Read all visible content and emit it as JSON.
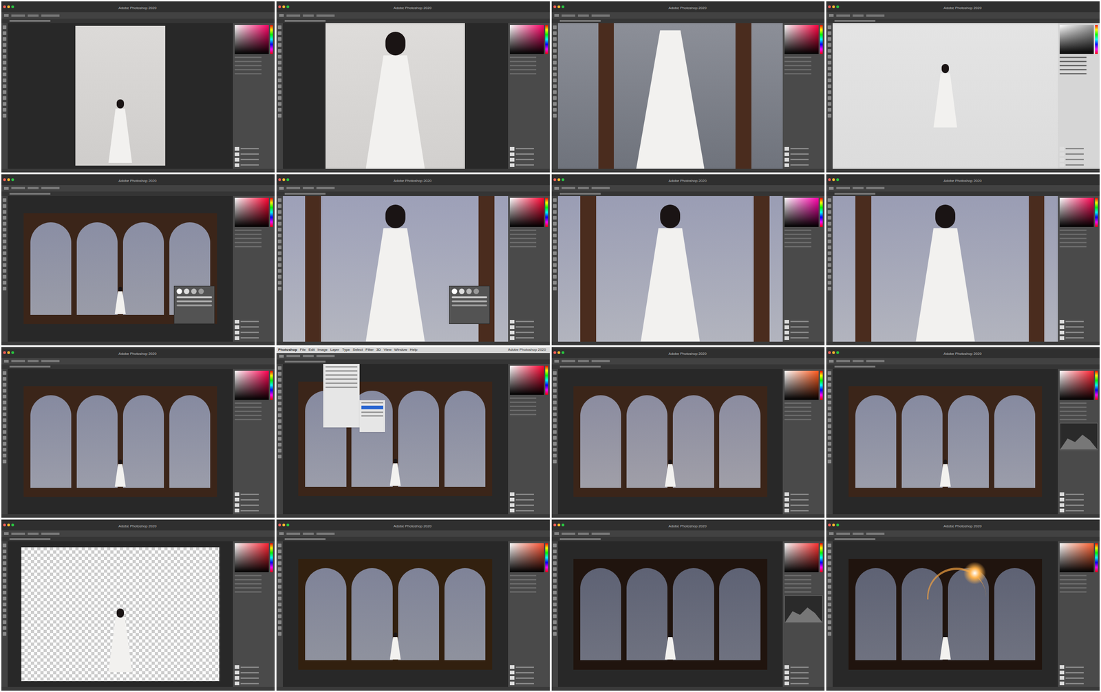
{
  "cells": [
    {
      "title": "Adobe Photoshop 2020",
      "kind": "studio-wide",
      "sky": "#dcdad8",
      "sea": "#cfcdcb",
      "frame": "#3b2519",
      "picker": "#ff0066",
      "overlay": "none"
    },
    {
      "title": "Adobe Photoshop 2020",
      "kind": "studio-zoom",
      "sky": "#dedcda",
      "sea": "#d2d0ce",
      "frame": "#3b2519",
      "picker": "#ff0066",
      "overlay": "none"
    },
    {
      "title": "Adobe Photoshop 2020",
      "kind": "closeup",
      "sky": "#8c8f98",
      "sea": "#6f737c",
      "frame": "#4a2c1e",
      "picker": "#ff0040",
      "overlay": "none"
    },
    {
      "title": "Adobe Photoshop 2020",
      "kind": "dialog",
      "sky": "#e4e4e4",
      "sea": "#dcdcdc",
      "frame": "#3b2519",
      "picker": "#9a9a9a",
      "overlay": "none"
    },
    {
      "title": "Adobe Photoshop 2020",
      "kind": "arches",
      "sky": "#8a8ea4",
      "sea": "#9a9ca8",
      "frame": "#3b2519",
      "picker": "#ff0030",
      "overlay": "brush"
    },
    {
      "title": "Adobe Photoshop 2020",
      "kind": "zoom",
      "sky": "#9da0b8",
      "sea": "#b4b6c0",
      "frame": "#4a2c1e",
      "picker": "#ff0030",
      "overlay": "brush"
    },
    {
      "title": "Adobe Photoshop 2020",
      "kind": "zoom",
      "sky": "#9a9db4",
      "sea": "#b2b4be",
      "frame": "#4a2c1e",
      "picker": "#ff00aa",
      "overlay": "none"
    },
    {
      "title": "Adobe Photoshop 2020",
      "kind": "zoom",
      "sky": "#9a9db4",
      "sea": "#b2b4be",
      "frame": "#4a2c1e",
      "picker": "#ff0050",
      "overlay": "none"
    },
    {
      "title": "Adobe Photoshop 2020",
      "kind": "arches",
      "sky": "#868aa0",
      "sea": "#9b9daa",
      "frame": "#3b2519",
      "picker": "#ff0050",
      "overlay": "none"
    },
    {
      "title": "Adobe Photoshop 2020",
      "kind": "arches",
      "sky": "#868aa0",
      "sea": "#9b9daa",
      "frame": "#3b2519",
      "picker": "#ff0030",
      "overlay": "menu",
      "menubar": [
        "Photoshop",
        "File",
        "Edit",
        "Image",
        "Layer",
        "Type",
        "Select",
        "Filter",
        "3D",
        "View",
        "Window",
        "Help"
      ]
    },
    {
      "title": "Adobe Photoshop 2020",
      "kind": "arches",
      "sky": "#8b8ca0",
      "sea": "#a09fa8",
      "frame": "#3b2519",
      "picker": "#ff5a1e",
      "overlay": "none"
    },
    {
      "title": "Adobe Photoshop 2020",
      "kind": "arches",
      "sky": "#868aa0",
      "sea": "#9b9daa",
      "frame": "#3b2519",
      "picker": "#ff2030",
      "overlay": "curves"
    },
    {
      "title": "Adobe Photoshop 2020",
      "kind": "cutout",
      "sky": "#ffffff",
      "sea": "#cccccc",
      "frame": "#3b2519",
      "picker": "#ff2030",
      "overlay": "none"
    },
    {
      "title": "Adobe Photoshop 2020",
      "kind": "arches",
      "sky": "#7f8398",
      "sea": "#8f929e",
      "frame": "#32200f",
      "picker": "#ff5030",
      "overlay": "none"
    },
    {
      "title": "Adobe Photoshop 2020",
      "kind": "arches",
      "sky": "#5e6274",
      "sea": "#6f7280",
      "frame": "#20140e",
      "picker": "#ff3030",
      "overlay": "curves"
    },
    {
      "title": "Adobe Photoshop 2020",
      "kind": "arches",
      "sky": "#5e6274",
      "sea": "#6f7280",
      "frame": "#20140e",
      "picker": "#ff6030",
      "overlay": "flare"
    }
  ]
}
